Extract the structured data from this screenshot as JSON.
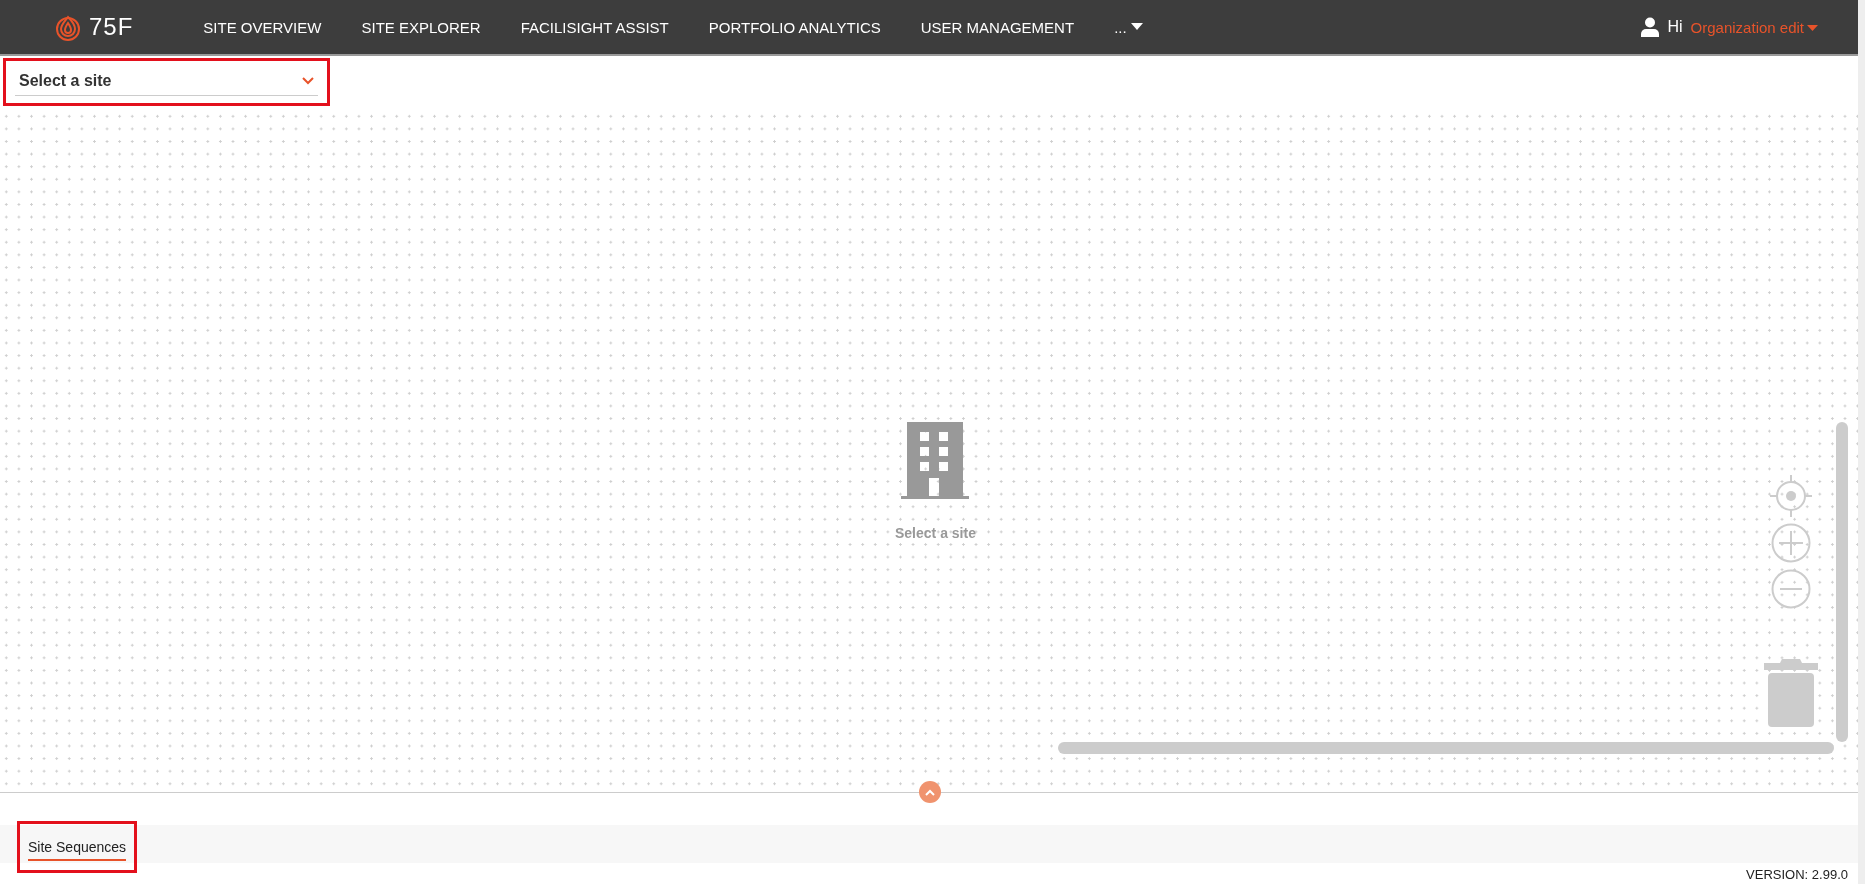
{
  "header": {
    "logo_text": "75F",
    "nav": [
      {
        "label": "SITE OVERVIEW",
        "kind": "link"
      },
      {
        "label": "SITE EXPLORER",
        "kind": "link"
      },
      {
        "label": "FACILISIGHT ASSIST",
        "kind": "link"
      },
      {
        "label": "PORTFOLIO ANALYTICS",
        "kind": "link"
      },
      {
        "label": "USER MANAGEMENT",
        "kind": "link"
      },
      {
        "label": "...",
        "kind": "more"
      }
    ],
    "greeting": "Hi",
    "user_menu": "Organization edit"
  },
  "site_select": {
    "placeholder": "Select a site",
    "highlighted": true
  },
  "canvas": {
    "empty_message": "Select a site"
  },
  "tabs": [
    {
      "label": "Site Sequences",
      "selected": true,
      "highlighted": true
    }
  ],
  "version": "VERSION: 2.99.0"
}
